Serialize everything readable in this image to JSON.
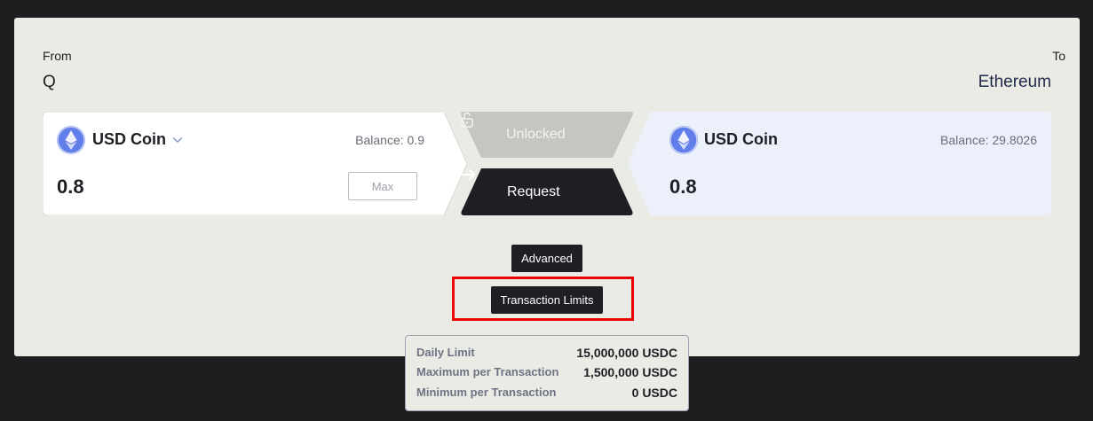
{
  "from": {
    "label": "From",
    "network": "Q"
  },
  "to": {
    "label": "To",
    "network": "Ethereum"
  },
  "source_token": {
    "name": "USD Coin",
    "icon": "ethereum-icon",
    "balance": "Balance: 0.9",
    "amount": "0.8",
    "max_label": "Max"
  },
  "dest_token": {
    "name": "USD Coin",
    "icon": "ethereum-icon",
    "balance": "Balance: 29.8026",
    "amount": "0.8"
  },
  "actions": {
    "unlocked_label": "Unlocked",
    "request_label": "Request",
    "advanced_label": "Advanced",
    "limits_label": "Transaction Limits"
  },
  "limits": [
    {
      "label": "Daily Limit",
      "value": "15,000,000 USDC"
    },
    {
      "label": "Maximum per Transaction",
      "value": "1,500,000 USDC"
    },
    {
      "label": "Minimum per Transaction",
      "value": "0 USDC"
    }
  ],
  "colors": {
    "page_bg": "#1e1e20",
    "panel_bg": "#ebebe6",
    "dest_card_bg": "#ebf0fb",
    "dark_button": "#1e1f24",
    "disabled_button": "#c6c6c1",
    "token_icon": "#627eea",
    "highlight": "#ee0000"
  }
}
